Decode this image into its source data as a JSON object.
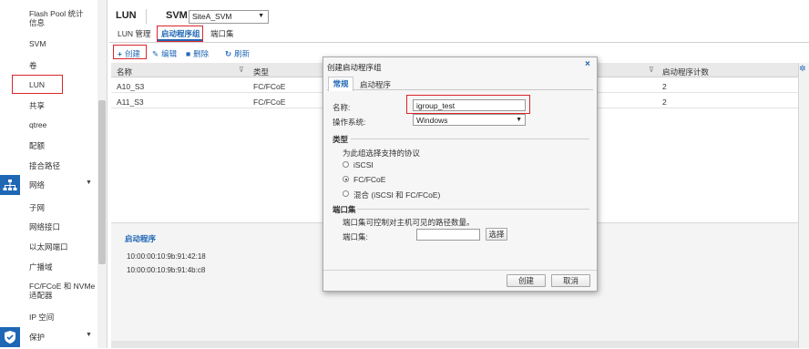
{
  "sidebar": {
    "items": [
      {
        "name": "flash-pool-stats",
        "label": "Flash Pool 统计\n信息"
      },
      {
        "name": "svm",
        "label": "SVM"
      },
      {
        "name": "volumes",
        "label": "卷"
      },
      {
        "name": "lun",
        "label": "LUN"
      },
      {
        "name": "shares",
        "label": "共享"
      },
      {
        "name": "qtree",
        "label": "qtree"
      },
      {
        "name": "quota",
        "label": "配额"
      },
      {
        "name": "junction-path",
        "label": "接合路径"
      },
      {
        "name": "subnet",
        "label": "子网"
      },
      {
        "name": "network-interface",
        "label": "网络接口"
      },
      {
        "name": "ethernet-port",
        "label": "以太网端口"
      },
      {
        "name": "broadcast-domain",
        "label": "广播域"
      },
      {
        "name": "fc-fcoe-nvme-adapter",
        "label": "FC/FCoE 和 NVMe\n适配器"
      },
      {
        "name": "ipspace",
        "label": "IP 空间"
      }
    ],
    "sections": [
      {
        "name": "network",
        "label": "网络",
        "icon": "network-icon"
      },
      {
        "name": "protection",
        "label": "保护",
        "icon": "shield-icon"
      }
    ]
  },
  "header": {
    "title": "LUN",
    "svm_label": "SVM",
    "svm_value": "SiteA_SVM",
    "tabs": [
      "LUN 管理",
      "启动程序组",
      "端口集"
    ]
  },
  "toolbar": {
    "create": "创建",
    "edit": "编辑",
    "delete": "删除",
    "refresh": "刷新"
  },
  "table": {
    "columns": [
      "名称",
      "类型",
      "启动程序计数"
    ],
    "rows": [
      {
        "name": "A10_S3",
        "type": "FC/FCoE",
        "count": "2"
      },
      {
        "name": "A11_S3",
        "type": "FC/FCoE",
        "count": "2"
      }
    ]
  },
  "detail": {
    "title": "启动程序",
    "initiators": [
      "10:00:00:10:9b:91:42:18",
      "10:00:00:10:9b:91:4b:c8"
    ]
  },
  "dialog": {
    "title": "创建启动程序组",
    "tabs": [
      "常规",
      "启动程序"
    ],
    "name_label": "名称:",
    "name_value": "igroup_test",
    "os_label": "操作系统:",
    "os_value": "Windows",
    "type_section": "类型",
    "type_hint": "为此组选择支持的协议",
    "protocols": [
      "iSCSI",
      "FC/FCoE",
      "混合 (iSCSI 和 FC/FCoE)"
    ],
    "selected_protocol": "FC/FCoE",
    "portset_section": "端口集",
    "portset_hint": "端口集可控制对主机可见的路径数量。",
    "portset_label": "端口集:",
    "portset_value": "",
    "choose_button": "选择",
    "create_button": "创建",
    "cancel_button": "取消"
  },
  "colors": {
    "accent": "#1f67b5",
    "highlight": "#d9252c"
  }
}
